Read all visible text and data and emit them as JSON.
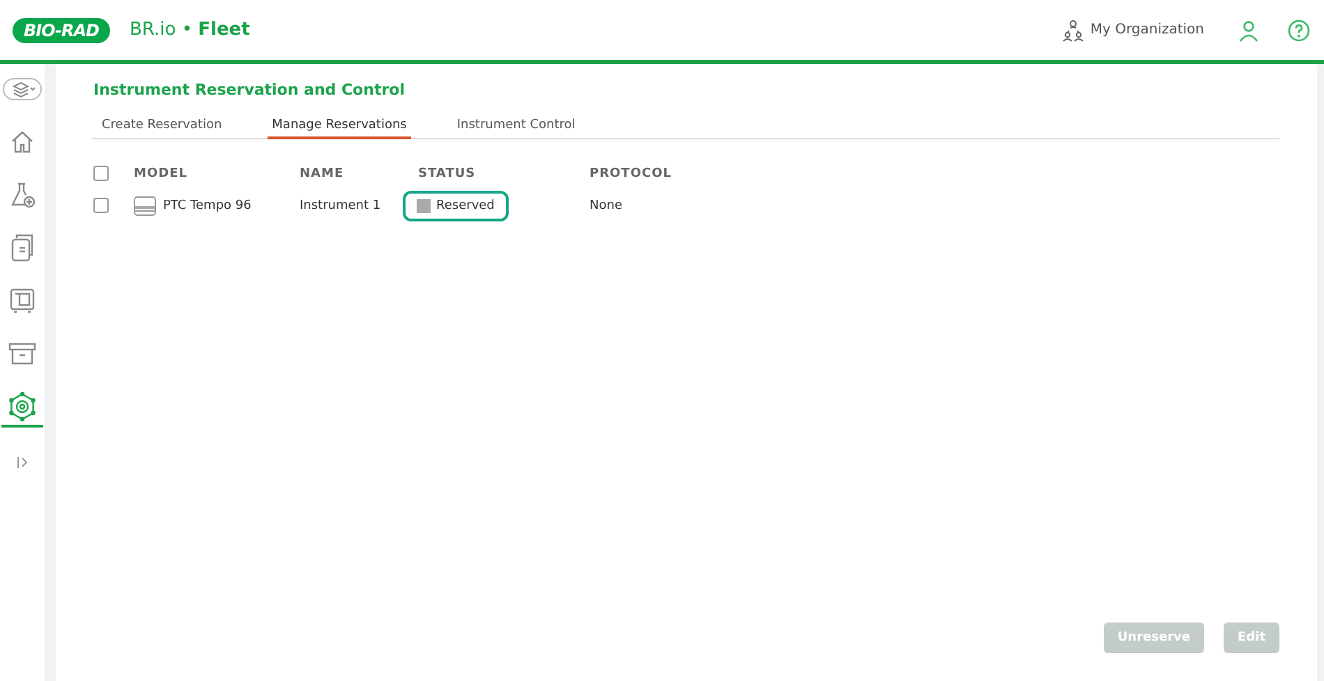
{
  "header": {
    "logo": "BIO-RAD",
    "app_name": "BR.io",
    "separator": "•",
    "app_section": "Fleet",
    "organization": "My Organization"
  },
  "sidebar": {
    "items": [
      {
        "kind": "layers",
        "selected": false
      },
      {
        "kind": "home",
        "selected": false
      },
      {
        "kind": "flask",
        "selected": false
      },
      {
        "kind": "document",
        "selected": false
      },
      {
        "kind": "monitor",
        "selected": false
      },
      {
        "kind": "archive",
        "selected": false
      },
      {
        "kind": "gear",
        "selected": true
      },
      {
        "kind": "expand",
        "selected": false
      }
    ]
  },
  "page": {
    "title": "Instrument Reservation and Control",
    "tabs": [
      {
        "label": "Create Reservation",
        "selected": false
      },
      {
        "label": "Manage Reservations",
        "selected": true
      },
      {
        "label": "Instrument Control",
        "selected": false
      }
    ]
  },
  "table": {
    "select_all_checked": false,
    "columns": [
      "MODEL",
      "NAME",
      "STATUS",
      "PROTOCOL"
    ],
    "rows": [
      {
        "checked": false,
        "model": "PTC Tempo 96",
        "name": "Instrument 1",
        "status": "Reserved",
        "status_checked": true,
        "status_highlighted": true,
        "protocol": "None"
      }
    ]
  },
  "buttons": [
    {
      "label": "Unreserve",
      "disabled": true
    },
    {
      "label": "Edit",
      "disabled": true
    }
  ]
}
